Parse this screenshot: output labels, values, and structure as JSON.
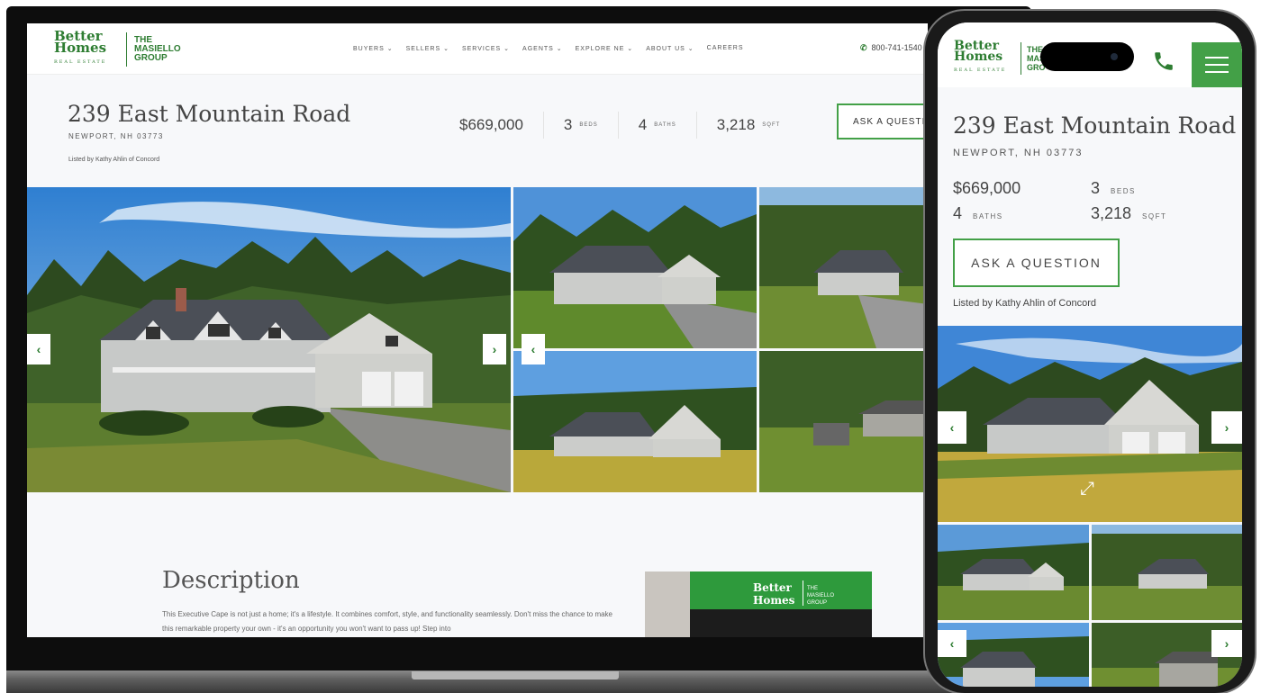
{
  "desktop": {
    "logo": {
      "brand_line1": "Better",
      "brand_line2": "Homes",
      "brand_sub": "REAL ESTATE",
      "group_line1": "THE",
      "group_line2": "MASIELLO",
      "group_line3": "GROUP"
    },
    "nav": [
      "BUYERS ⌄",
      "SELLERS ⌄",
      "SERVICES ⌄",
      "AGENTS ⌄",
      "EXPLORE NE ⌄",
      "ABOUT US ⌄",
      "CAREERS"
    ],
    "phone": "800-741-1540",
    "listing": {
      "title": "239 East Mountain Road",
      "address": "NEWPORT, NH 03773",
      "listed_by": "Listed by Kathy Ahlin of Concord",
      "price": "$669,000",
      "beds_value": "3",
      "beds_label": "BEDS",
      "baths_value": "4",
      "baths_label": "BATHS",
      "sqft_value": "3,218",
      "sqft_label": "SQFT",
      "ask_button": "ASK A QUESTIO"
    },
    "description": {
      "heading": "Description",
      "text": "This Executive Cape is not just a home; it's a lifestyle. It combines comfort, style, and functionality seamlessly. Don't miss the chance to make this remarkable property your own - it's an opportunity you won't want to pass up! Step into"
    },
    "arrows": {
      "prev": "‹",
      "next": "›"
    }
  },
  "mobile": {
    "logo": {
      "brand_line1": "Better",
      "brand_line2": "Homes",
      "brand_sub": "REAL ESTATE",
      "group_line1": "THE",
      "group_line2": "MAS",
      "group_line3": "GRO"
    },
    "listing": {
      "title": "239 East Mountain Road",
      "address": "NEWPORT, NH 03773",
      "price": "$669,000",
      "beds_value": "3",
      "beds_label": "BEDS",
      "baths_value": "4",
      "baths_label": "BATHS",
      "sqft_value": "3,218",
      "sqft_label": "SQFT",
      "ask_button": "ASK A QUESTION",
      "listed_by": "Listed by Kathy Ahlin of Concord"
    },
    "arrows": {
      "prev": "‹",
      "next": "›"
    },
    "expand_icon": "⤢"
  },
  "colors": {
    "brand_green": "#43a047",
    "dark_green": "#2e7d32"
  }
}
